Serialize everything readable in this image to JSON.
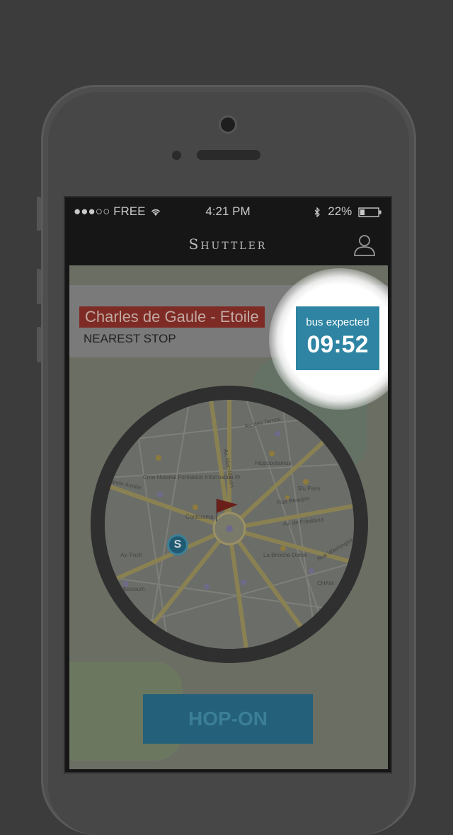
{
  "status_bar": {
    "carrier": "●●●○○ FREE",
    "time": "4:21 PM",
    "battery": "22%"
  },
  "navbar": {
    "title": "Shuttler",
    "profile_icon": "user-icon"
  },
  "stop_card": {
    "stop_name": "Charles de Gaule  - Etoile",
    "subtitle": "NEAREST STOP"
  },
  "eta": {
    "label": "bus expected",
    "time": "09:52"
  },
  "map": {
    "street_labels": [
      "Av. des Ternes",
      "Hippopotamus",
      "Av. Mac-Mahon",
      "Cnre Notarial Formation Information Pr",
      "Grande Armée",
      "Rue Beaujon",
      "Sfu Paris",
      "Conforama",
      "Av. de Friedland",
      "Av. Foch",
      "La Brioche Dorée",
      "Rue Washington",
      "Musseum",
      "CHAM"
    ],
    "shuttle_marker": "S"
  },
  "cta": {
    "label": "HOP-ON"
  },
  "colors": {
    "accent": "#2e84a2",
    "stop_badge": "#c0392b"
  }
}
